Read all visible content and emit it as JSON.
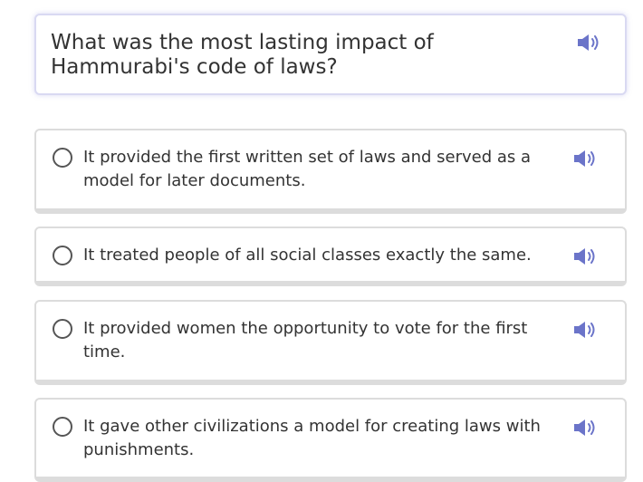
{
  "question": {
    "text": "What was the most lasting impact of Hammurabi's code of laws?",
    "audio_icon": "speaker-icon"
  },
  "answers": [
    {
      "text": "It provided the first written set of laws and served as a model for later documents.",
      "selected": false
    },
    {
      "text": "It treated people of all social classes exactly the same.",
      "selected": false
    },
    {
      "text": "It provided women the opportunity to vote for the first time.",
      "selected": false
    },
    {
      "text": "It gave other civilizations a model for creating laws with punishments.",
      "selected": false
    }
  ],
  "colors": {
    "speaker_icon": "#6b74c9",
    "card_border": "#dcdcdc",
    "question_border": "#d9d9f2",
    "text": "#333333"
  }
}
